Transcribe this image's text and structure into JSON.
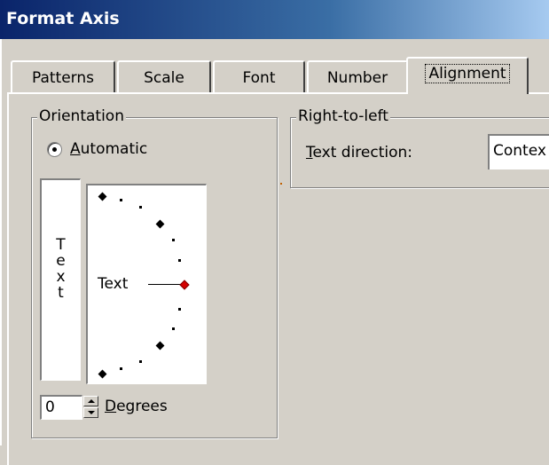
{
  "window": {
    "title": "Format Axis"
  },
  "tabs": [
    {
      "label": "Patterns"
    },
    {
      "label": "Scale"
    },
    {
      "label": "Font"
    },
    {
      "label": "Number"
    },
    {
      "label": "Alignment"
    }
  ],
  "active_tab": "Alignment",
  "orientation": {
    "legend": "Orientation",
    "automatic_radio": {
      "label_underlined": "A",
      "label_rest": "utomatic",
      "checked": true
    },
    "vertical_text": [
      "T",
      "e",
      "x",
      "t"
    ],
    "dial_text": "Text",
    "degrees": {
      "value": "0",
      "label_underlined": "D",
      "label_rest": "egrees"
    }
  },
  "right_to_left": {
    "legend": "Right-to-left",
    "text_direction": {
      "label_underlined": "T",
      "label_rest": "ext direction:",
      "value": "Contex"
    }
  },
  "colors": {
    "title_gradient_start": "#0a246a",
    "title_gradient_end": "#a6caf0",
    "dialog_face": "#d4d0c8",
    "dial_indicator": "#d40000"
  }
}
